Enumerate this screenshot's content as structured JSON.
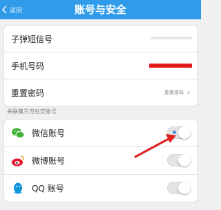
{
  "header": {
    "back_label": "返回",
    "title": "账号与安全"
  },
  "account": [
    {
      "label": "子弹短信号"
    },
    {
      "label": "手机号码"
    },
    {
      "label": "重置密码",
      "value": "重置密码"
    }
  ],
  "social_section_title": "关联第三方社交账号",
  "social": [
    {
      "label": "微信账号",
      "icon": "wechat-icon",
      "enabled": false
    },
    {
      "label": "微博账号",
      "icon": "weibo-icon",
      "enabled": false
    },
    {
      "label": "QQ 账号",
      "icon": "qq-icon",
      "enabled": false
    }
  ],
  "colors": {
    "header": "#2f9be9",
    "arrow": "#e02020",
    "redaction": "#e41b1b"
  }
}
